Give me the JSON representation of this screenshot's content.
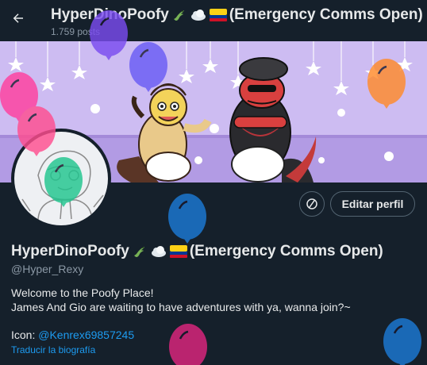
{
  "topbar": {
    "title": "HyperDinoPoofy",
    "title_suffix": "(Emergency Comms Open)",
    "post_count": "1.759 posts"
  },
  "profile": {
    "name": "HyperDinoPoofy",
    "name_suffix": "(Emergency Comms Open)",
    "handle": "@Hyper_Rexy",
    "bio_line1": "Welcome to the Poofy Place!",
    "bio_line2": "James And Gio are waiting to have adventures with ya, wanna join?~",
    "icon_label": "Icon: ",
    "icon_link": "@Kenrex69857245",
    "translate_label": "Traducir la biografía",
    "edit_label": "Editar perfil"
  },
  "icons": {
    "back": "arrow-left-icon",
    "circle_button": "prohibit-circle-icon",
    "name_emojis": [
      "lizard-emoji",
      "cloud-emoji",
      "colombia-flag-emoji"
    ]
  },
  "colors": {
    "background": "#15202b",
    "accent": "#1d9bf0",
    "secondary_text": "#8b98a5",
    "banner": "#cdbcf2"
  }
}
